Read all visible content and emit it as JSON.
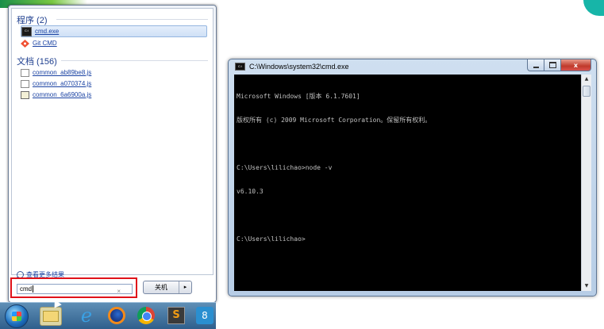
{
  "start_menu": {
    "programs_header": "程序 (2)",
    "programs": [
      {
        "label": "cmd.exe",
        "icon": "cmd-icon",
        "selected": true
      },
      {
        "label": "Git CMD",
        "icon": "git-icon",
        "selected": false
      }
    ],
    "documents_header": "文档 (156)",
    "documents": [
      {
        "label": "common_ab89be8.js",
        "icon": "document-icon"
      },
      {
        "label": "common_a070374.js",
        "icon": "document-icon"
      },
      {
        "label": "common_6a6900a.js",
        "icon": "js-file-icon"
      }
    ],
    "see_more": "查看更多结果",
    "search_value": "cmd",
    "clear_glyph": "×",
    "shutdown_label": "关机",
    "shutdown_arrow": "▸",
    "highlight_color": "#e0121a"
  },
  "taskbar": {
    "items": [
      "start-orb",
      "file-explorer-icon",
      "internet-explorer-icon",
      "firefox-icon",
      "chrome-icon",
      "sublime-text-icon",
      "app-icon"
    ],
    "sublime_glyph": "S",
    "last_glyph": "8",
    "ie_glyph": "e"
  },
  "cmd_window": {
    "title": "C:\\Windows\\system32\\cmd.exe",
    "close_glyph": "x",
    "console_lines": [
      "Microsoft Windows [版本 6.1.7601]",
      "版权所有 (c) 2009 Microsoft Corporation。保留所有权利。",
      "",
      "C:\\Users\\lilichao>node -v",
      "v6.10.3",
      "",
      "C:\\Users\\lilichao>"
    ],
    "scroll_up": "▲",
    "scroll_down": "▼"
  }
}
